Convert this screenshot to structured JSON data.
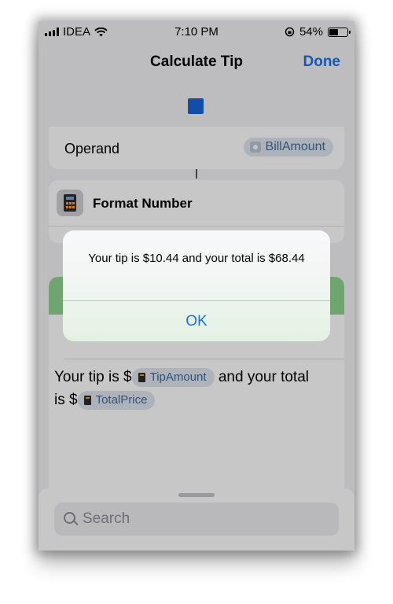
{
  "status_bar": {
    "carrier": "IDEA",
    "time": "7:10 PM",
    "battery_percent": "54%",
    "battery_level": 0.54
  },
  "nav": {
    "title": "Calculate Tip",
    "done_label": "Done"
  },
  "operand_card": {
    "label": "Operand",
    "variable": "BillAmount"
  },
  "format_card": {
    "title": "Format Number"
  },
  "alert_card": {
    "message_prefix": "Your tip is $",
    "tip_variable": "TipAmount",
    "message_middle": "and your total is $",
    "total_variable": "TotalPrice"
  },
  "search": {
    "placeholder": "Search"
  },
  "dialog": {
    "message": "Your tip is $10.44 and your total is $68.44",
    "ok_label": "OK"
  },
  "colors": {
    "accent": "#1a73e8",
    "stop_button": "#1565d8",
    "alert_header": "#8fd48f"
  }
}
